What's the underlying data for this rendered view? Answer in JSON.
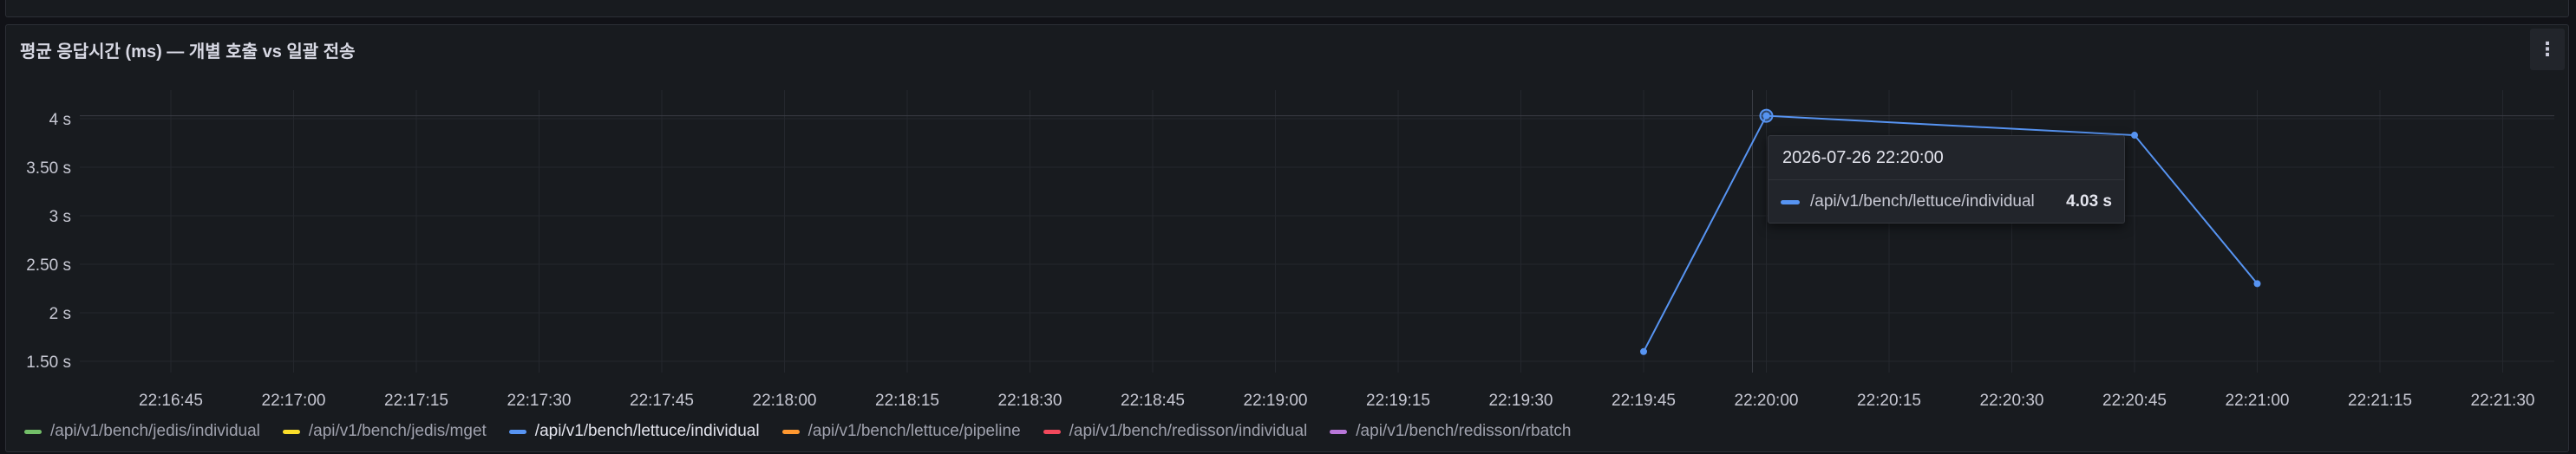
{
  "panel": {
    "title": "평균 응답시간 (ms) — 개별 호출 vs 일괄 전송",
    "menu_icon": "kebab-menu-icon"
  },
  "chart_data": {
    "type": "line",
    "title": "평균 응답시간 (ms) — 개별 호출 vs 일괄 전송",
    "xlabel": "",
    "ylabel": "",
    "x_ticks": [
      "22:16:45",
      "22:17:00",
      "22:17:15",
      "22:17:30",
      "22:17:45",
      "22:18:00",
      "22:18:15",
      "22:18:30",
      "22:18:45",
      "22:19:00",
      "22:19:15",
      "22:19:30",
      "22:19:45",
      "22:20:00",
      "22:20:15",
      "22:20:30",
      "22:20:45",
      "22:21:00",
      "22:21:15",
      "22:21:30"
    ],
    "y_ticks": [
      "1.50 s",
      "2 s",
      "2.50 s",
      "3 s",
      "3.50 s",
      "4 s"
    ],
    "y_tick_values": [
      1.5,
      2,
      2.5,
      3,
      3.5,
      4
    ],
    "ylim": [
      1.3,
      4.3
    ],
    "grid": true,
    "legend_position": "bottom-left",
    "series": [
      {
        "name": "/api/v1/bench/jedis/individual",
        "color": "#73bf69",
        "points": []
      },
      {
        "name": "/api/v1/bench/jedis/mget",
        "color": "#fade2a",
        "points": []
      },
      {
        "name": "/api/v1/bench/lettuce/individual",
        "color": "#5794f2",
        "points": [
          {
            "x": "22:19:45",
            "y": 1.6
          },
          {
            "x": "22:20:00",
            "y": 4.03
          },
          {
            "x": "22:20:45",
            "y": 3.83
          },
          {
            "x": "22:21:00",
            "y": 2.3
          }
        ]
      },
      {
        "name": "/api/v1/bench/lettuce/pipeline",
        "color": "#ff9830",
        "points": []
      },
      {
        "name": "/api/v1/bench/redisson/individual",
        "color": "#f2495c",
        "points": []
      },
      {
        "name": "/api/v1/bench/redisson/rbatch",
        "color": "#b877d9",
        "points": []
      }
    ]
  },
  "tooltip": {
    "time": "2026-07-26 22:20:00",
    "series_name": "/api/v1/bench/lettuce/individual",
    "value": "4.03 s",
    "hovered_x": "22:20:00",
    "hovered_y": 4.03
  }
}
